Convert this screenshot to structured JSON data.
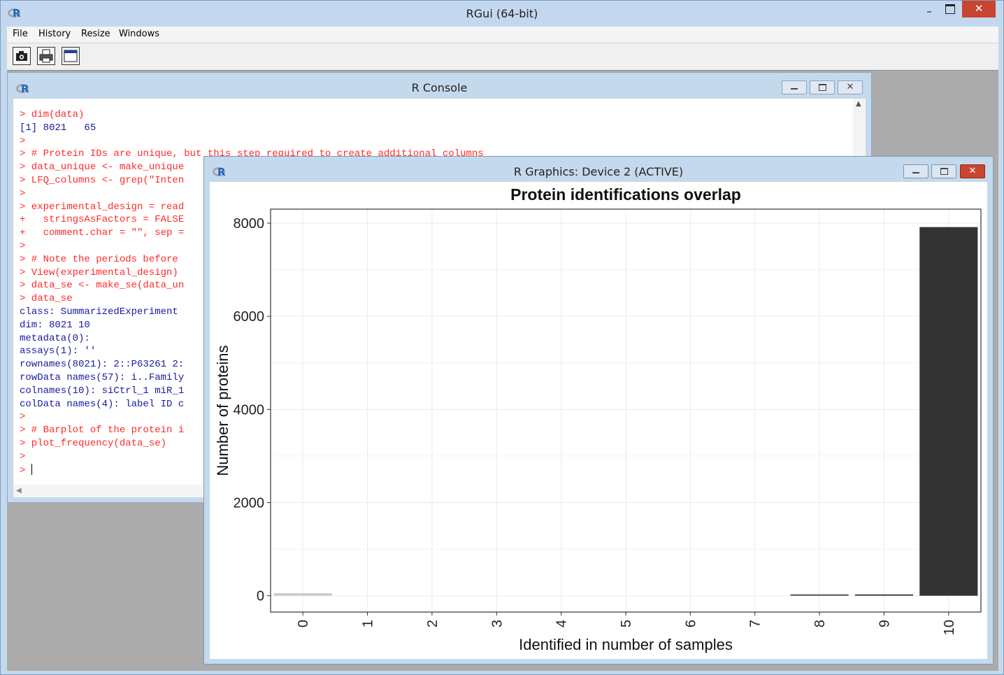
{
  "app": {
    "title": "RGui (64-bit)",
    "minimize": "–",
    "maximize": "☐",
    "close": "✕"
  },
  "menu": {
    "file": "File",
    "history": "History",
    "resize": "Resize",
    "windows": "Windows"
  },
  "toolbar": {
    "icons": [
      "camera-icon",
      "print-icon",
      "window-icon"
    ]
  },
  "console": {
    "title": "R Console",
    "lines": [
      {
        "t": "> dim(data)",
        "k": "cmd"
      },
      {
        "t": "[1] 8021   65",
        "k": "out"
      },
      {
        "t": ">",
        "k": "cmd"
      },
      {
        "t": "> # Protein IDs are unique, but this step required to create additional columns",
        "k": "cmd"
      },
      {
        "t": "> data_unique <- make_unique",
        "k": "cmd"
      },
      {
        "t": "> LFQ_columns <- grep(\"Inten",
        "k": "cmd"
      },
      {
        "t": ">",
        "k": "cmd"
      },
      {
        "t": "> experimental_design = read",
        "k": "cmd"
      },
      {
        "t": "+   stringsAsFactors = FALSE",
        "k": "cmd"
      },
      {
        "t": "+   comment.char = \"\", sep =",
        "k": "cmd"
      },
      {
        "t": ">",
        "k": "cmd"
      },
      {
        "t": "> # Note the periods before",
        "k": "cmd"
      },
      {
        "t": "> View(experimental_design)",
        "k": "cmd"
      },
      {
        "t": "> data_se <- make_se(data_un",
        "k": "cmd"
      },
      {
        "t": "> data_se",
        "k": "cmd"
      },
      {
        "t": "class: SummarizedExperiment",
        "k": "out"
      },
      {
        "t": "dim: 8021 10",
        "k": "out"
      },
      {
        "t": "metadata(0):",
        "k": "out"
      },
      {
        "t": "assays(1): ''",
        "k": "out"
      },
      {
        "t": "rownames(8021): 2::P63261 2:",
        "k": "out"
      },
      {
        "t": "rowData names(57): i..Family",
        "k": "out"
      },
      {
        "t": "colnames(10): siCtrl_1 miR_1",
        "k": "out"
      },
      {
        "t": "colData names(4): label ID c",
        "k": "out"
      },
      {
        "t": ">",
        "k": "cmd"
      },
      {
        "t": "> # Barplot of the protein i",
        "k": "cmd"
      },
      {
        "t": "> plot_frequency(data_se)",
        "k": "cmd"
      },
      {
        "t": ">",
        "k": "cmd"
      },
      {
        "t": "> ",
        "k": "cmd",
        "cursor": true
      }
    ]
  },
  "graphics": {
    "title": "R Graphics: Device 2 (ACTIVE)"
  },
  "chart_data": {
    "type": "bar",
    "title": "Protein identifications overlap",
    "xlabel": "Identified in number of samples",
    "ylabel": "Number of proteins",
    "categories": [
      "0",
      "1",
      "2",
      "3",
      "4",
      "5",
      "6",
      "7",
      "8",
      "9",
      "10"
    ],
    "values": [
      55,
      0,
      0,
      0,
      0,
      0,
      0,
      0,
      8,
      12,
      7915
    ],
    "colors": [
      "#cccccc",
      "#c4c4c4",
      "#bcbcbc",
      "#b0b0b0",
      "#a0a0a0",
      "#8e8e8e",
      "#7a7a7a",
      "#666666",
      "#555555",
      "#444444",
      "#333333"
    ],
    "yticks": [
      0,
      2000,
      4000,
      6000,
      8000
    ],
    "ylim": [
      -350,
      8300
    ],
    "grid": true
  }
}
